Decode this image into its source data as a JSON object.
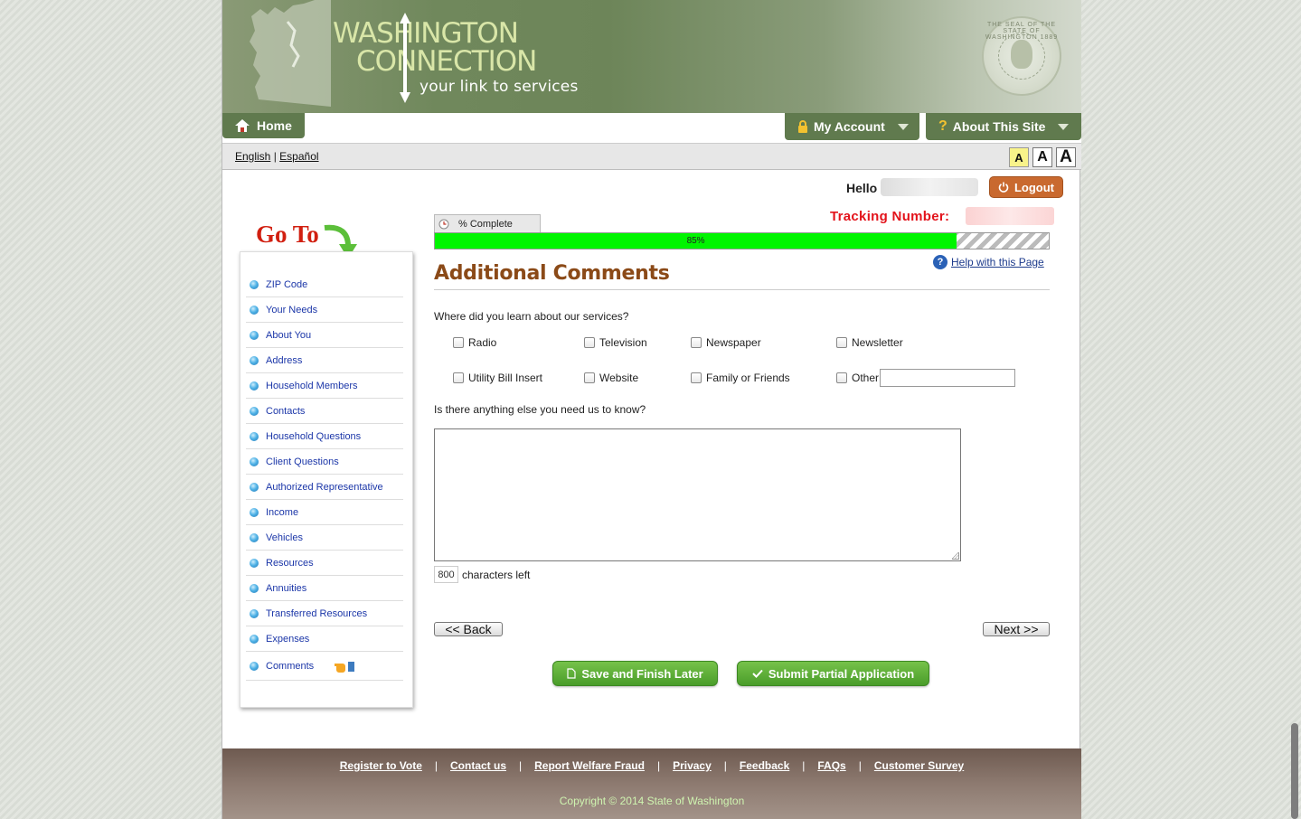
{
  "header": {
    "logo_line1": "WASHINGTON",
    "logo_line2": "CONNECTION",
    "logo_tagline": "your link to services",
    "seal_text": "THE SEAL OF THE STATE OF WASHINGTON 1889"
  },
  "nav": {
    "home": "Home",
    "my_account": "My Account",
    "about": "About This Site"
  },
  "lang": {
    "english": "English",
    "separator": "|",
    "spanish": "Español",
    "font_sizes": [
      "A",
      "A",
      "A"
    ]
  },
  "user": {
    "hello": "Hello",
    "logout": "Logout",
    "tracking_label": "Tracking Number:"
  },
  "sidebar": {
    "goto": "Go To",
    "items": [
      {
        "label": "ZIP Code"
      },
      {
        "label": "Your Needs"
      },
      {
        "label": "About You"
      },
      {
        "label": "Address"
      },
      {
        "label": "Household Members"
      },
      {
        "label": "Contacts"
      },
      {
        "label": "Household Questions"
      },
      {
        "label": "Client Questions"
      },
      {
        "label": "Authorized Representative"
      },
      {
        "label": "Income"
      },
      {
        "label": "Vehicles"
      },
      {
        "label": "Resources"
      },
      {
        "label": "Annuities"
      },
      {
        "label": "Transferred Resources"
      },
      {
        "label": "Expenses"
      },
      {
        "label": "Comments"
      }
    ]
  },
  "progress": {
    "tab_label": "% Complete",
    "value_label": "85%",
    "fraction": 0.85
  },
  "page": {
    "help": "Help with this Page",
    "title": "Additional Comments",
    "question1": "Where did you learn about our services?",
    "sources": [
      "Radio",
      "Television",
      "Newspaper",
      "Newsletter",
      "Utility Bill Insert",
      "Website",
      "Family or Friends",
      "Other"
    ],
    "question2": "Is there anything else you need us to know?",
    "chars_left_value": "800",
    "chars_left_label": "characters left",
    "back": "<< Back",
    "next": "Next >>",
    "save": "Save and Finish Later",
    "submit": "Submit Partial Application"
  },
  "footer": {
    "links": [
      "Register to Vote",
      "Contact us",
      "Report Welfare Fraud",
      "Privacy",
      "Feedback",
      "FAQs",
      "Customer Survey"
    ],
    "copyright": "Copyright © 2014 State of Washington"
  },
  "colors": {
    "nav_green": "#607a4e",
    "progress_green": "#00f500",
    "title_brown": "#8b4a18",
    "tracking_red": "#e3131b",
    "logout_orange": "#c9692f",
    "link_blue": "#1b36a8"
  }
}
